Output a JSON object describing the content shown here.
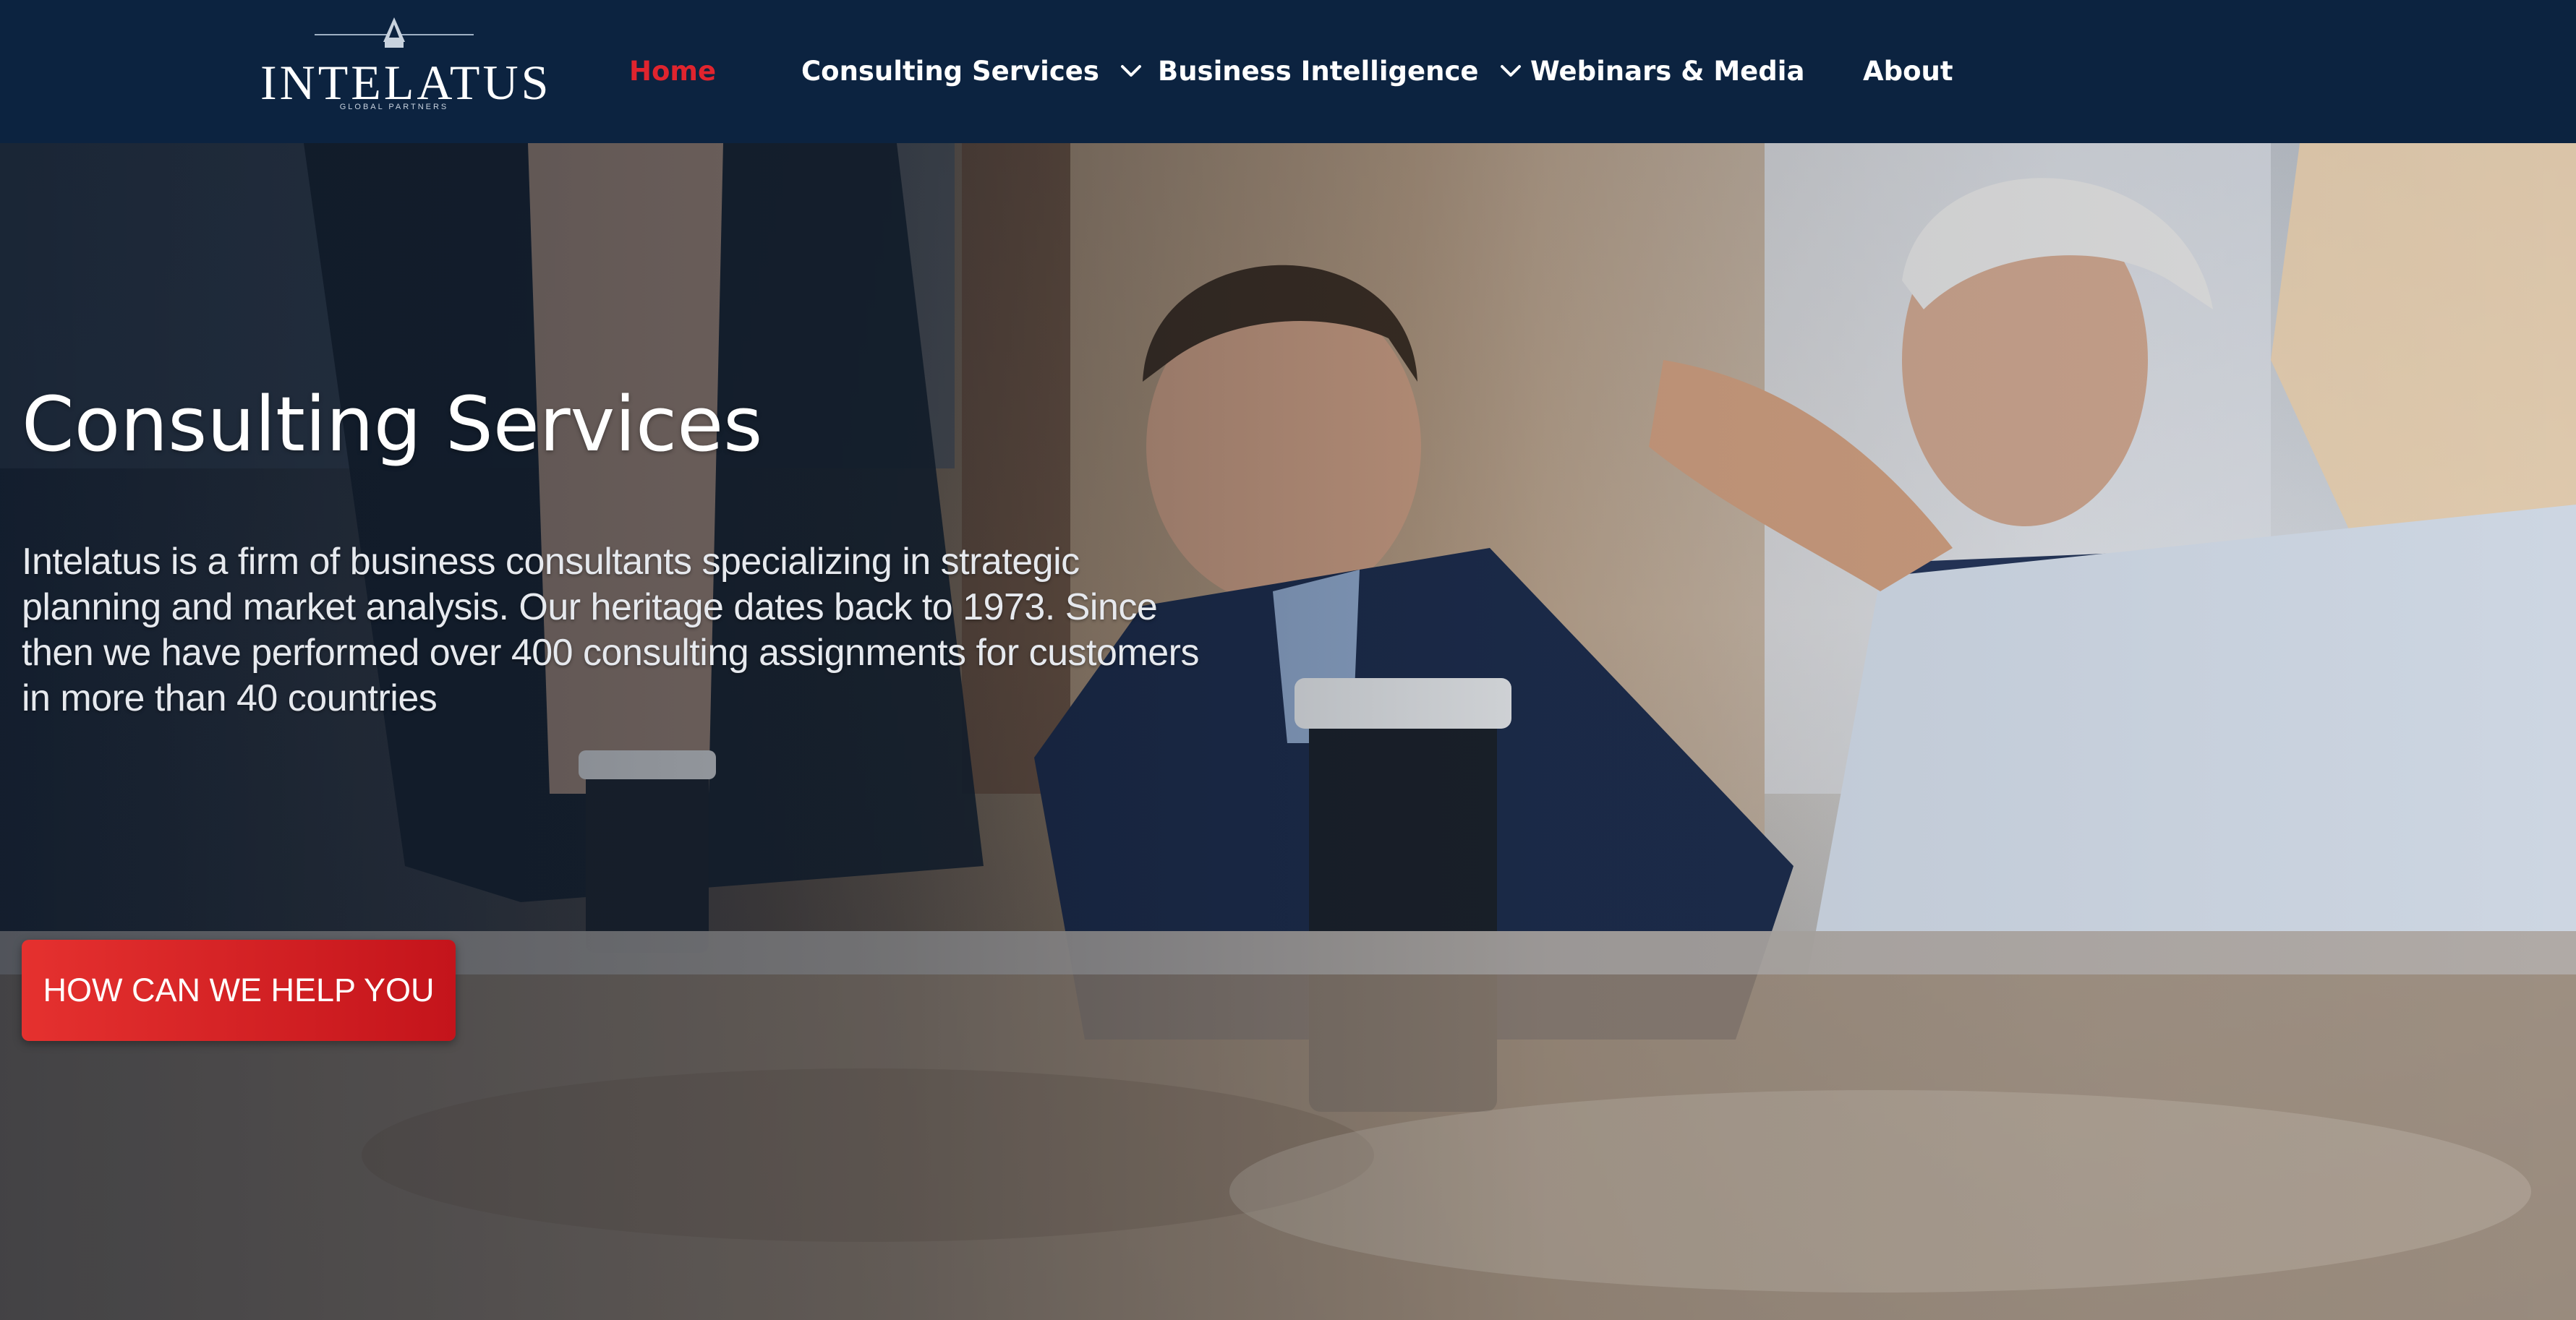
{
  "brand": {
    "name": "INTELATUS",
    "tagline": "GLOBAL PARTNERS",
    "accent_color": "#e0242e",
    "nav_bg_color": "#0c2340"
  },
  "nav": {
    "items": [
      {
        "label": "Home",
        "active": true,
        "has_dropdown": false
      },
      {
        "label": "Consulting Services",
        "active": false,
        "has_dropdown": true
      },
      {
        "label": "Business Intelligence",
        "active": false,
        "has_dropdown": true
      },
      {
        "label": "Webinars & Media",
        "active": false,
        "has_dropdown": false
      },
      {
        "label": "About",
        "active": false,
        "has_dropdown": false
      }
    ],
    "dropdown_icon": "chevron-down-icon"
  },
  "hero": {
    "title": "Consulting Services",
    "description": "Intelatus is a firm of business consultants specializing in strategic planning and market analysis. Our heritage dates back to 1973. Since then we have performed over 400 consulting assignments for customers in more than 40 countries",
    "cta_label": "HOW CAN WE HELP YOU",
    "cta_color": "#d8212a",
    "background_image": "business-meeting-photo"
  }
}
